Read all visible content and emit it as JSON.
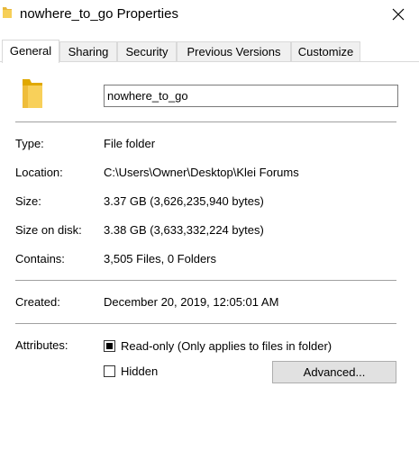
{
  "window": {
    "title": "nowhere_to_go Properties"
  },
  "tabs": [
    {
      "label": "General"
    },
    {
      "label": "Sharing"
    },
    {
      "label": "Security"
    },
    {
      "label": "Previous Versions"
    },
    {
      "label": "Customize"
    }
  ],
  "general": {
    "name_value": "nowhere_to_go",
    "type": {
      "label": "Type:",
      "value": "File folder"
    },
    "location": {
      "label": "Location:",
      "value": "C:\\Users\\Owner\\Desktop\\Klei Forums"
    },
    "size": {
      "label": "Size:",
      "value": "3.37 GB (3,626,235,940 bytes)"
    },
    "size_on_disk": {
      "label": "Size on disk:",
      "value": "3.38 GB (3,633,332,224 bytes)"
    },
    "contains": {
      "label": "Contains:",
      "value": "3,505 Files, 0 Folders"
    },
    "created": {
      "label": "Created:",
      "value": "December 20, 2019, 12:05:01 AM"
    },
    "attributes": {
      "label": "Attributes:",
      "read_only_label": "Read-only (Only applies to files in folder)",
      "read_only_state": "indeterminate",
      "hidden_label": "Hidden",
      "hidden_checked": false,
      "advanced_label": "Advanced..."
    }
  },
  "colors": {
    "folder": "#f5c542",
    "folder_dark": "#e0a800",
    "tab_active_bg": "#ffffff",
    "tab_bg": "#f0f0f0"
  },
  "icons": {
    "title": "folder-icon",
    "close": "close-icon",
    "big": "folder-icon"
  }
}
